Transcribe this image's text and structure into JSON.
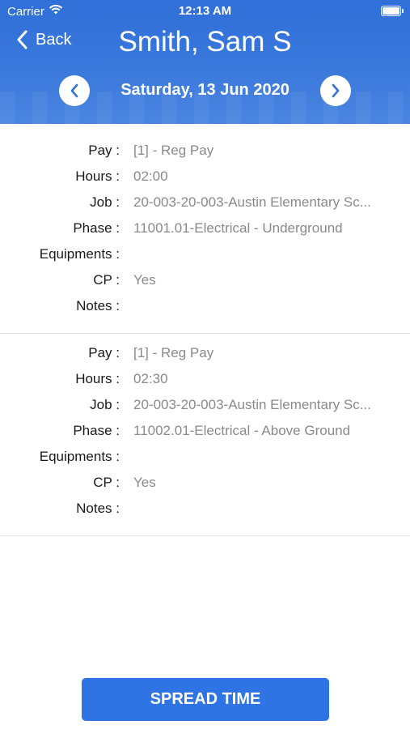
{
  "status_bar": {
    "carrier": "Carrier",
    "time": "12:13 AM",
    "icons": [
      "wifi-icon",
      "battery-icon"
    ]
  },
  "header": {
    "back_label": "Back",
    "title": "Smith, Sam S",
    "date": "Saturday, 13 Jun 2020",
    "accent_color": "#2f6fd8"
  },
  "entries": [
    {
      "rows": [
        {
          "label": "Pay :",
          "value": "[1] - Reg Pay"
        },
        {
          "label": "Hours :",
          "value": "02:00"
        },
        {
          "label": "Job :",
          "value": "20-003-20-003-Austin Elementary Sc..."
        },
        {
          "label": "Phase :",
          "value": "11001.01-Electrical - Underground"
        },
        {
          "label": "Equipments :",
          "value": ""
        },
        {
          "label": "CP :",
          "value": "Yes"
        },
        {
          "label": "Notes :",
          "value": ""
        }
      ]
    },
    {
      "rows": [
        {
          "label": "Pay :",
          "value": "[1] - Reg Pay"
        },
        {
          "label": "Hours :",
          "value": "02:30"
        },
        {
          "label": "Job :",
          "value": "20-003-20-003-Austin Elementary Sc..."
        },
        {
          "label": "Phase :",
          "value": "11002.01-Electrical - Above Ground"
        },
        {
          "label": "Equipments :",
          "value": ""
        },
        {
          "label": "CP :",
          "value": "Yes"
        },
        {
          "label": "Notes :",
          "value": ""
        }
      ]
    }
  ],
  "footer": {
    "spread_label": "SPREAD TIME",
    "button_color": "#2f74e4"
  }
}
